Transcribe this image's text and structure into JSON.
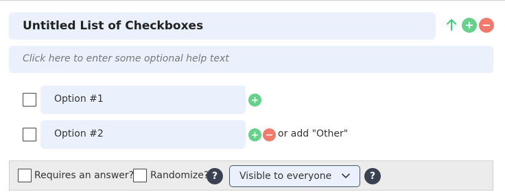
{
  "field": {
    "title": "Untitled List of Checkboxes",
    "help_placeholder": "Click here to enter some optional help text"
  },
  "header_controls": {
    "move_up_icon": "arrow-up-icon",
    "add_icon": "plus-icon",
    "remove_icon": "minus-icon",
    "add_glyph": "+",
    "remove_glyph": "−"
  },
  "options": [
    {
      "label": "Option #1",
      "checked": false
    },
    {
      "label": "Option #2",
      "checked": false
    }
  ],
  "option_controls": {
    "add_glyph": "+",
    "remove_glyph": "−",
    "add_other_text": "or add \"Other\""
  },
  "footer": {
    "required_label": "Requires an answer?",
    "randomize_label": "Randomize?",
    "help_glyph": "?",
    "visibility_selected": "Visible to everyone"
  },
  "colors": {
    "input_bg": "#eaf1fd",
    "add_green": "#65d18a",
    "remove_red": "#f07b6d",
    "arrow_green": "#3ec87a",
    "help_dark": "#3a4150"
  }
}
